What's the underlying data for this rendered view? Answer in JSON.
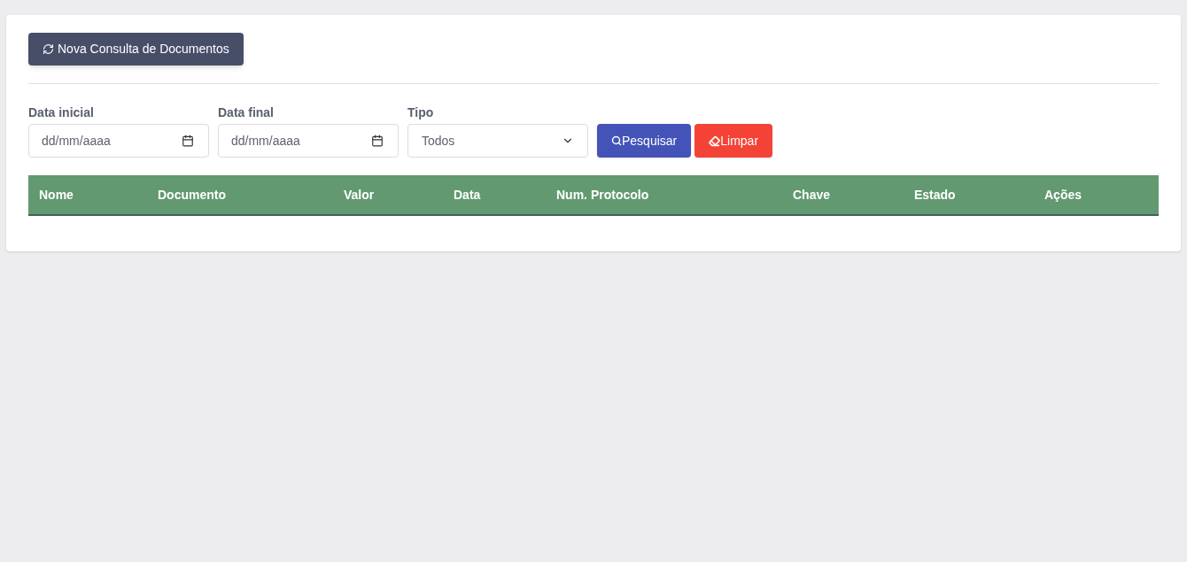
{
  "new_query_button": {
    "label": "Nova Consulta de Documentos"
  },
  "filters": [
    {
      "kind": "date",
      "label": "Data inicial",
      "placeholder": "dd/mm/aaaa"
    },
    {
      "kind": "date",
      "label": "Data final",
      "placeholder": "dd/mm/aaaa"
    },
    {
      "kind": "select",
      "label": "Tipo",
      "value": "Todos"
    }
  ],
  "actions": [
    {
      "kind": "search",
      "label": "Pesquisar"
    },
    {
      "kind": "clear",
      "label": "Limpar"
    }
  ],
  "table": {
    "columns": [
      "Nome",
      "Documento",
      "Valor",
      "Data",
      "Num. Protocolo",
      "Chave",
      "Estado",
      "Ações"
    ]
  }
}
